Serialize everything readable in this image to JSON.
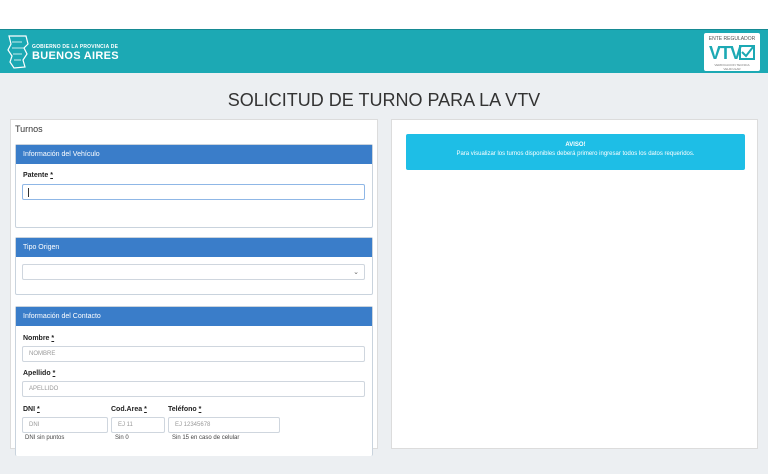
{
  "header": {
    "gov_small": "GOBIERNO DE LA PROVINCIA DE",
    "gov_big": "BUENOS AIRES",
    "vtv_top": "ENTE REGULADOR",
    "vtv_logo": "VTV",
    "vtv_bottom": "VERIFICACION TECNICA VEHICULAR",
    "accent": "#1ca9b4"
  },
  "page": {
    "title": "SOLICITUD DE TURNO PARA LA VTV"
  },
  "left": {
    "section_title": "Turnos",
    "vehicle": {
      "header": "Información del Vehículo",
      "patente_label": "Patente",
      "req": "*",
      "patente_value": ""
    },
    "origen": {
      "header": "Tipo Origen",
      "selected": ""
    },
    "contact": {
      "header": "Información del Contacto",
      "nombre_label": "Nombre",
      "nombre_placeholder": "NOMBRE",
      "apellido_label": "Apellido",
      "apellido_placeholder": "APELLIDO",
      "dni_label": "DNI",
      "dni_placeholder": "DNI",
      "dni_hint": "DNI sin puntos",
      "area_label": "Cod.Area",
      "area_placeholder": "EJ 11",
      "area_hint": "Sin 0",
      "tel_label": "Teléfono",
      "tel_placeholder": "EJ 12345678",
      "tel_hint": "Sin 15 en caso de celular"
    }
  },
  "right": {
    "alert_title": "AVISO!",
    "alert_body": "Para visualizar los turnos disponibles deberá primero ingresar todos los datos requeridos.",
    "alert_color": "#1ebee6"
  },
  "colors": {
    "panel_header": "#3a7dc9"
  }
}
